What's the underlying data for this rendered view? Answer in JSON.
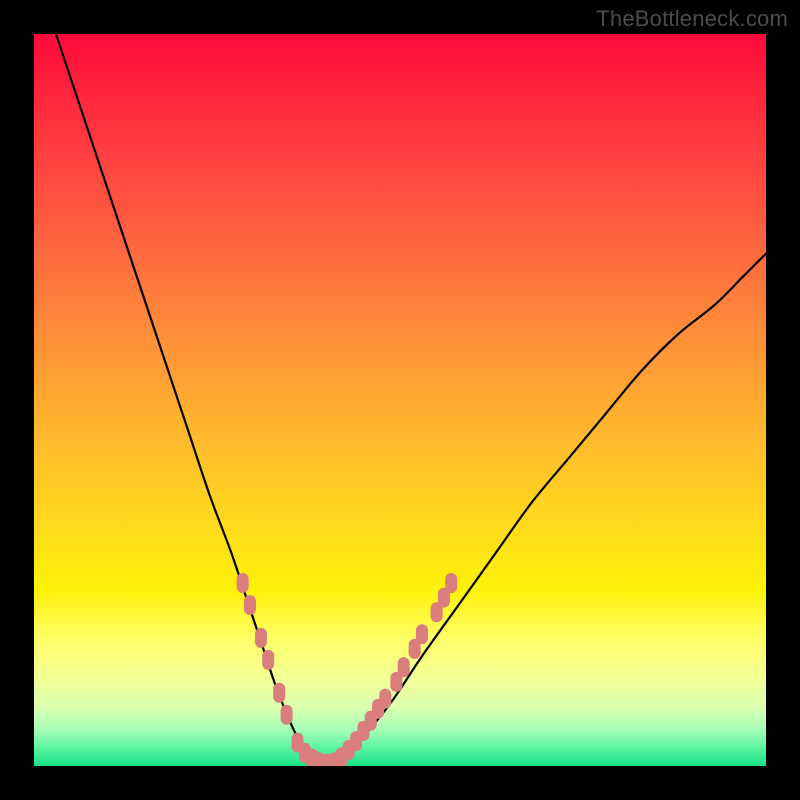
{
  "watermark": "TheBottleneck.com",
  "colors": {
    "curve": "#000000",
    "markers": "#d97d7d",
    "background_top": "#ff0a3a",
    "background_bottom": "#19e08a",
    "frame": "#000000"
  },
  "chart_data": {
    "type": "line",
    "title": "",
    "xlabel": "",
    "ylabel": "",
    "xlim": [
      0,
      100
    ],
    "ylim": [
      0,
      100
    ],
    "grid": false,
    "legend": false,
    "series": [
      {
        "name": "bottleneck-curve",
        "x": [
          3,
          6,
          9,
          12,
          15,
          18,
          21,
          24,
          27,
          29,
          31,
          33,
          35,
          36.5,
          38,
          40,
          42,
          45,
          49,
          53,
          58,
          63,
          68,
          73,
          78,
          83,
          88,
          93,
          97,
          100
        ],
        "y": [
          100,
          91,
          82,
          73,
          64,
          55,
          46,
          37,
          29,
          23,
          17,
          11,
          6,
          3,
          1,
          0,
          1,
          4,
          9,
          15,
          22,
          29,
          36,
          42,
          48,
          54,
          59,
          63,
          67,
          70
        ]
      }
    ],
    "markers": {
      "name": "highlight-points",
      "points": [
        {
          "x": 28.5,
          "y": 25
        },
        {
          "x": 29.5,
          "y": 22
        },
        {
          "x": 31.0,
          "y": 17.5
        },
        {
          "x": 32.0,
          "y": 14.5
        },
        {
          "x": 33.5,
          "y": 10
        },
        {
          "x": 34.5,
          "y": 7
        },
        {
          "x": 36.0,
          "y": 3.2
        },
        {
          "x": 37.0,
          "y": 1.8
        },
        {
          "x": 38.0,
          "y": 1
        },
        {
          "x": 39.0,
          "y": 0.5
        },
        {
          "x": 40.0,
          "y": 0.3
        },
        {
          "x": 41.0,
          "y": 0.5
        },
        {
          "x": 42.0,
          "y": 1.2
        },
        {
          "x": 43.0,
          "y": 2.2
        },
        {
          "x": 44.0,
          "y": 3.4
        },
        {
          "x": 45.0,
          "y": 4.8
        },
        {
          "x": 46.0,
          "y": 6.2
        },
        {
          "x": 47.0,
          "y": 7.8
        },
        {
          "x": 48.0,
          "y": 9.2
        },
        {
          "x": 49.5,
          "y": 11.5
        },
        {
          "x": 50.5,
          "y": 13.5
        },
        {
          "x": 52.0,
          "y": 16
        },
        {
          "x": 53.0,
          "y": 18
        },
        {
          "x": 55.0,
          "y": 21
        },
        {
          "x": 56.0,
          "y": 23
        },
        {
          "x": 57.0,
          "y": 25
        }
      ]
    }
  }
}
